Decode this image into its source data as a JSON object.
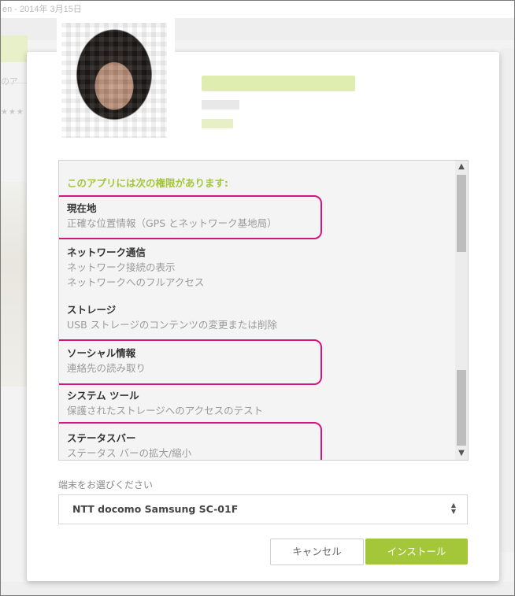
{
  "background": {
    "date_text": "en - 2014年 3月15日",
    "snippet_text": "のア",
    "stars": "★★★"
  },
  "dialog": {
    "avatar_label": "app-developer-avatar",
    "permissions_header": "このアプリには次の権限があります:",
    "permissions": [
      {
        "title": "現在地",
        "details": [
          "正確な位置情報（GPS とネットワーク基地局）"
        ],
        "highlighted": true
      },
      {
        "title": "ネットワーク通信",
        "details": [
          "ネットワーク接続の表示",
          "ネットワークへのフルアクセス"
        ],
        "highlighted": false
      },
      {
        "title": "ストレージ",
        "details": [
          "USB ストレージのコンテンツの変更または削除"
        ],
        "highlighted": false
      },
      {
        "title": "ソーシャル情報",
        "details": [
          "連絡先の読み取り"
        ],
        "highlighted": true
      },
      {
        "title": "システム ツール",
        "details": [
          "保護されたストレージへのアクセスのテスト"
        ],
        "highlighted": false
      },
      {
        "title": "ステータスバー",
        "details": [
          "ステータス バーの拡大/縮小"
        ],
        "highlighted": true
      }
    ],
    "device_label": "端末をお選びください",
    "device_selected": "NTT docomo Samsung SC-01F",
    "cancel_label": "キャンセル",
    "install_label": "インストール"
  },
  "colors": {
    "accent_green": "#a4c639",
    "highlight_magenta": "#d4157e"
  }
}
